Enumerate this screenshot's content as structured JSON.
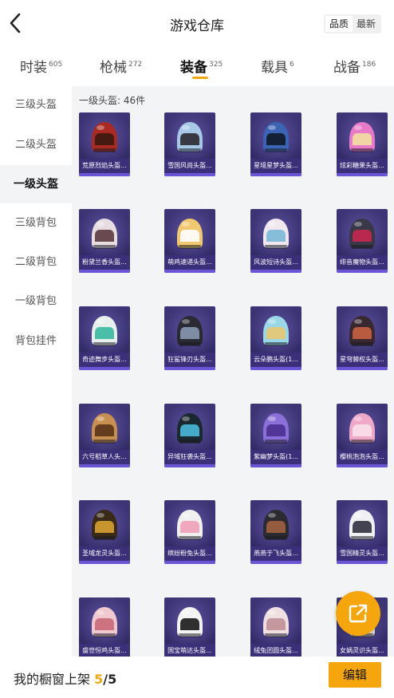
{
  "header": {
    "title": "游戏仓库",
    "sort": [
      "品质",
      "最新"
    ],
    "sort_active": 0
  },
  "tabs": [
    {
      "label": "时装",
      "count": "605"
    },
    {
      "label": "枪械",
      "count": "272"
    },
    {
      "label": "装备",
      "count": "325"
    },
    {
      "label": "载具",
      "count": "6"
    },
    {
      "label": "战备",
      "count": "186"
    }
  ],
  "tab_active": 2,
  "sidebar": {
    "items": [
      "三级头盔",
      "二级头盔",
      "一级头盔",
      "三级背包",
      "二级背包",
      "一级背包",
      "背包挂件"
    ],
    "active": 2
  },
  "section_label": "一级头盔: 46件",
  "items": [
    {
      "name": "荒原烈焰头盔...",
      "colors": [
        "#a82a20",
        "#3a1a10"
      ]
    },
    {
      "name": "雪国风尚头盔...",
      "colors": [
        "#a8c8e8",
        "#2a2a30"
      ]
    },
    {
      "name": "星境星梦头盔...",
      "colors": [
        "#3c64b4",
        "#101828"
      ]
    },
    {
      "name": "炫彩糖果头盔...",
      "colors": [
        "#e87ac8",
        "#f0e0a0"
      ]
    },
    {
      "name": "粉黛兰香头盔...",
      "colors": [
        "#e8dde0",
        "#5a3a40"
      ]
    },
    {
      "name": "萌鸡速递头盔...",
      "colors": [
        "#f0c870",
        "#ffffff"
      ]
    },
    {
      "name": "风波短诗头盔...",
      "colors": [
        "#f0e8ee",
        "#7ab8d8"
      ]
    },
    {
      "name": "绯音魔物头盔...",
      "colors": [
        "#383848",
        "#c82850"
      ]
    },
    {
      "name": "奇迹舞步头盔...",
      "colors": [
        "#e8f0ee",
        "#3ab8a0"
      ]
    },
    {
      "name": "狂鲨锋刃头盔...",
      "colors": [
        "#2a2a34",
        "#8898b0"
      ]
    },
    {
      "name": "云朵鹏头盔(1...",
      "colors": [
        "#9ad8e8",
        "#e8c870"
      ]
    },
    {
      "name": "星穹棘权头盔...",
      "colors": [
        "#3a2830",
        "#c86040"
      ]
    },
    {
      "name": "六号稻草人头...",
      "colors": [
        "#c89050",
        "#5a3418"
      ]
    },
    {
      "name": "异域狂袭头盔...",
      "colors": [
        "#1a2830",
        "#4ab8d8"
      ]
    },
    {
      "name": "紫幽梦头盔(1...",
      "colors": [
        "#8a70d8",
        "#4a3090"
      ]
    },
    {
      "name": "樱桃泡泡头盔...",
      "colors": [
        "#f0a8c8",
        "#f8e0ea"
      ]
    },
    {
      "name": "圣域龙灵头盔...",
      "colors": [
        "#3a2a18",
        "#d8a030"
      ]
    },
    {
      "name": "缤纷粉兔头盔...",
      "colors": [
        "#f0f0f0",
        "#f0a0b8"
      ]
    },
    {
      "name": "燕燕于飞头盔...",
      "colors": [
        "#2a2a30",
        "#a06040"
      ]
    },
    {
      "name": "雪国精灵头盔...",
      "colors": [
        "#f0f0f4",
        "#303040"
      ]
    },
    {
      "name": "盛世恒鸡头盔...",
      "colors": [
        "#f0c8d0",
        "#c86878"
      ]
    },
    {
      "name": "国宝萌达头盔...",
      "colors": [
        "#f4f4f4",
        "#1a1a1a"
      ]
    },
    {
      "name": "绒兔团圆头盔...",
      "colors": [
        "#f0e0e4",
        "#c09098"
      ]
    },
    {
      "name": "女娲灵识头盔...",
      "colors": [
        "#e8e0d0",
        "#8a6a40"
      ]
    }
  ],
  "fab": {
    "icon": "share-external-icon"
  },
  "footer": {
    "shelf_label": "我的橱窗上架",
    "shelf_count": "5",
    "shelf_total": "/5",
    "edit_label": "编辑"
  },
  "accent": "#f5a60d"
}
